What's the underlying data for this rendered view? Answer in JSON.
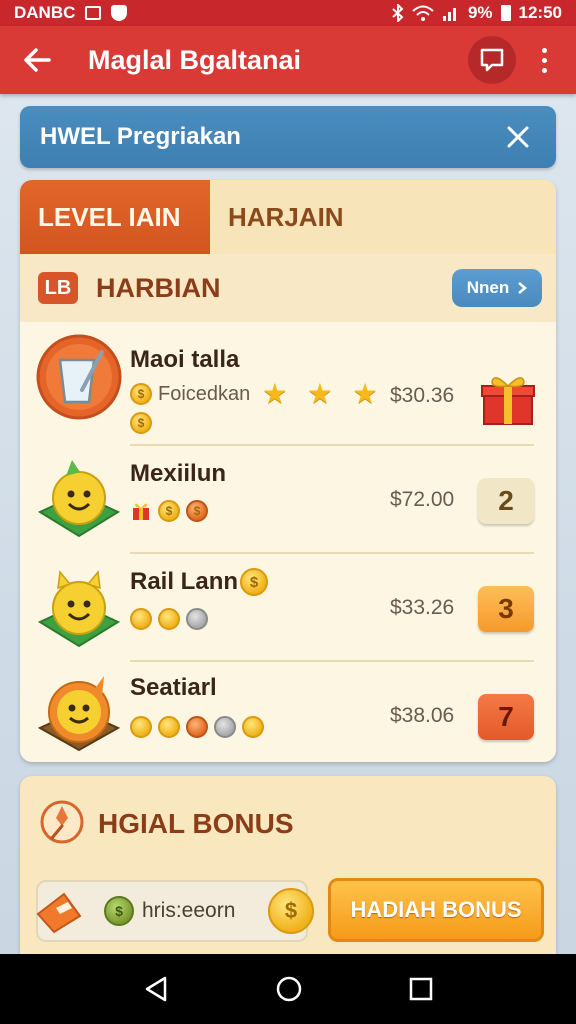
{
  "status_bar": {
    "left_text": "DANBC",
    "battery": "9%",
    "time": "12:50"
  },
  "app_bar": {
    "title": "Maglal Bgaltanai"
  },
  "banner": {
    "text": "HWEL Pregriakan"
  },
  "tabs": [
    {
      "label": "LEVEL IAIN",
      "active": true
    },
    {
      "label": "HARJAIN",
      "active": false
    }
  ],
  "section": {
    "icon_text": "LB",
    "title": "HARBIAN",
    "next_label": "Nnen"
  },
  "rows": [
    {
      "title": "Maoi talla",
      "subtitle": "Foicedkan",
      "stars": 3,
      "price": "$30.36",
      "reward": "gift"
    },
    {
      "title": "Mexiilun",
      "subtitle": "",
      "stars": 0,
      "price": "$72.00",
      "badge": "2"
    },
    {
      "title": "Rail Lann",
      "subtitle": "",
      "stars": 0,
      "price": "$33.26",
      "badge": "3"
    },
    {
      "title": "Seatiarl",
      "subtitle": "",
      "stars": 0,
      "price": "$38.06",
      "badge": "7"
    }
  ],
  "bonus": {
    "title": "HGIAL BONUS",
    "input_value": "hris:eeorn",
    "button_label": "HADIAH BONUS"
  },
  "colors": {
    "status_bar": "#c8282c",
    "app_bar": "#d93a36",
    "banner": "#4a8dbf",
    "tab_active": "#e2662a",
    "bonus_button": "#f59b1a"
  }
}
